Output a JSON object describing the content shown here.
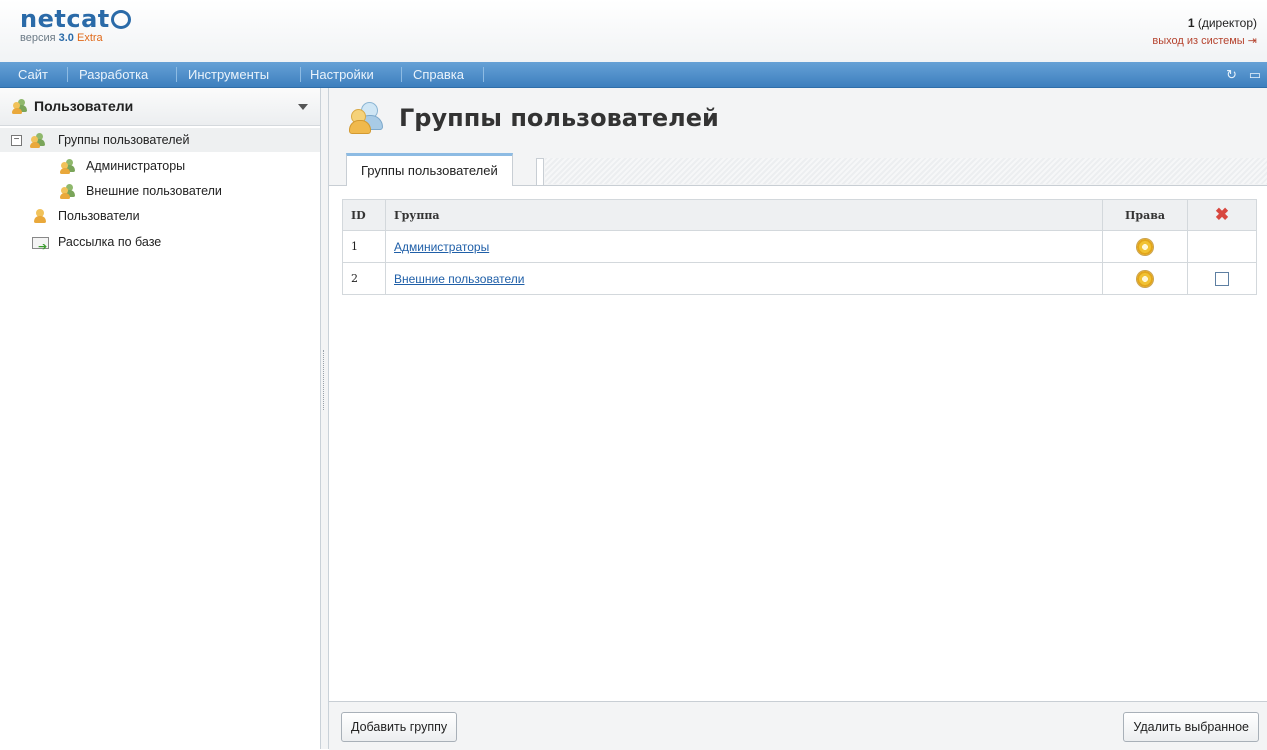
{
  "header": {
    "logo_text": "netcat",
    "version_prefix": "версия",
    "version_number": "3.0",
    "version_edition": "Extra",
    "user_id": "1",
    "user_role": "(директор)",
    "logout_label": "выход из системы"
  },
  "menu": {
    "items": [
      "Сайт",
      "Разработка",
      "Инструменты",
      "Настройки",
      "Справка"
    ],
    "right_icons": [
      "refresh-icon",
      "chat-icon"
    ]
  },
  "sidebar": {
    "title": "Пользователи",
    "tree": [
      {
        "label": "Группы пользователей",
        "icon": "users-group-icon",
        "expanded": true,
        "selected": true
      },
      {
        "label": "Администраторы",
        "icon": "users-group-icon"
      },
      {
        "label": "Внешние пользователи",
        "icon": "users-group-icon"
      },
      {
        "label": "Пользователи",
        "icon": "user-icon"
      },
      {
        "label": "Рассылка по базе",
        "icon": "mail-send-icon"
      }
    ]
  },
  "main": {
    "title": "Группы пользователей",
    "tab_label": "Группы пользователей",
    "table": {
      "headers": {
        "id": "ID",
        "group": "Группа",
        "rights": "Права",
        "delete": "delete-icon"
      },
      "rows": [
        {
          "id": "1",
          "group": "Администраторы",
          "rights": "gear-icon",
          "deletable": false
        },
        {
          "id": "2",
          "group": "Внешние пользователи",
          "rights": "gear-icon",
          "deletable": true
        }
      ]
    },
    "buttons": {
      "add": "Добавить группу",
      "delete": "Удалить выбранное"
    }
  },
  "colors": {
    "menubar": "#4a8ac8",
    "link": "#1f5fa8",
    "logout": "#b5432e",
    "accent": "#e06a1b"
  }
}
